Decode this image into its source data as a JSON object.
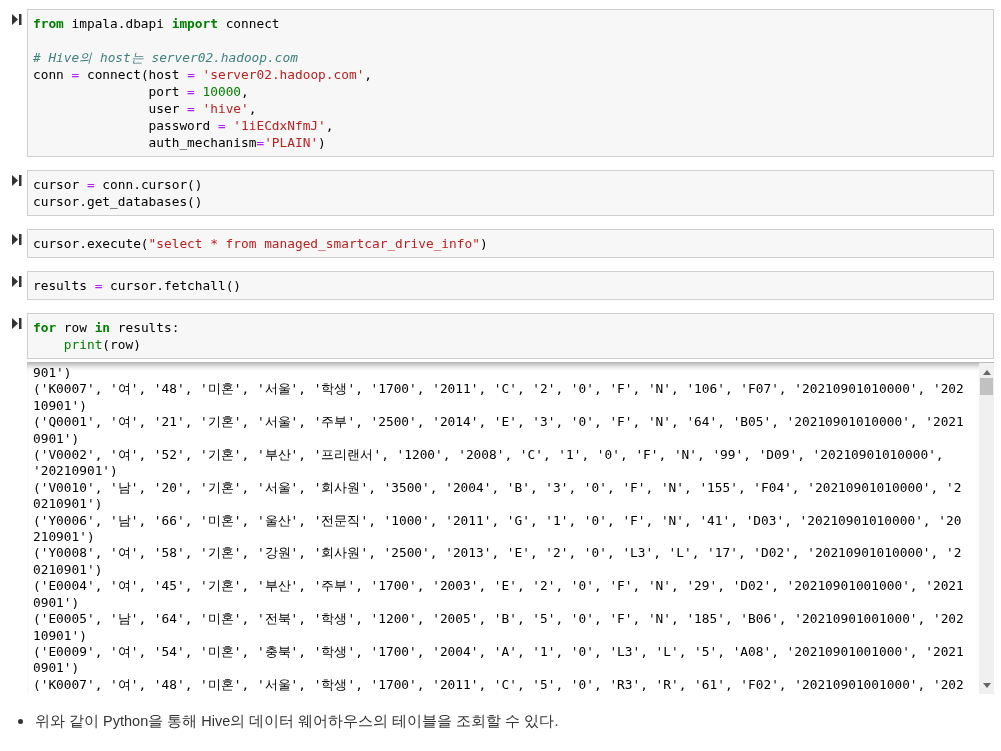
{
  "cells": [
    {
      "blocks": [
        [
          {
            "tokens": [
              {
                "kind": "kw",
                "text": "from"
              },
              {
                "kind": "plain",
                "text": " impala.dbapi "
              },
              {
                "kind": "kw",
                "text": "import"
              },
              {
                "kind": "plain",
                "text": " connect"
              }
            ]
          }
        ],
        [
          {
            "tokens": [
              {
                "kind": "comment",
                "text": "# Hive의 host는 server02.hadoop.com"
              }
            ]
          },
          {
            "tokens": [
              {
                "kind": "plain",
                "text": "conn "
              },
              {
                "kind": "op",
                "text": "="
              },
              {
                "kind": "plain",
                "text": " connect(host "
              },
              {
                "kind": "op",
                "text": "="
              },
              {
                "kind": "str",
                "text": " 'server02.hadoop.com'"
              },
              {
                "kind": "plain",
                "text": ","
              }
            ]
          },
          {
            "tokens": [
              {
                "kind": "plain",
                "text": "               port "
              },
              {
                "kind": "op",
                "text": "="
              },
              {
                "kind": "num",
                "text": " 10000"
              },
              {
                "kind": "plain",
                "text": ","
              }
            ]
          },
          {
            "tokens": [
              {
                "kind": "plain",
                "text": "               user "
              },
              {
                "kind": "op",
                "text": "="
              },
              {
                "kind": "str",
                "text": " 'hive'"
              },
              {
                "kind": "plain",
                "text": ","
              }
            ]
          },
          {
            "tokens": [
              {
                "kind": "plain",
                "text": "               password "
              },
              {
                "kind": "op",
                "text": "="
              },
              {
                "kind": "str",
                "text": " '1iECdxNfmJ'"
              },
              {
                "kind": "plain",
                "text": ","
              }
            ]
          },
          {
            "tokens": [
              {
                "kind": "plain",
                "text": "               auth_mechanism"
              },
              {
                "kind": "op",
                "text": "="
              },
              {
                "kind": "str",
                "text": "'PLAIN'"
              },
              {
                "kind": "plain",
                "text": ")"
              }
            ]
          }
        ]
      ]
    },
    {
      "blocks": [
        [
          {
            "tokens": [
              {
                "kind": "plain",
                "text": "cursor "
              },
              {
                "kind": "op",
                "text": "="
              },
              {
                "kind": "plain",
                "text": " conn.cursor()"
              }
            ]
          },
          {
            "tokens": [
              {
                "kind": "plain",
                "text": "cursor.get_databases()"
              }
            ]
          }
        ]
      ]
    },
    {
      "blocks": [
        [
          {
            "tokens": [
              {
                "kind": "plain",
                "text": "cursor.execute("
              },
              {
                "kind": "str",
                "text": "\"select * from managed_smartcar_drive_info\""
              },
              {
                "kind": "plain",
                "text": ")"
              }
            ]
          }
        ]
      ]
    },
    {
      "blocks": [
        [
          {
            "tokens": [
              {
                "kind": "plain",
                "text": "results "
              },
              {
                "kind": "op",
                "text": "="
              },
              {
                "kind": "plain",
                "text": " cursor.fetchall()"
              }
            ]
          }
        ]
      ]
    },
    {
      "blocks": [
        [
          {
            "tokens": [
              {
                "kind": "kw",
                "text": "for"
              },
              {
                "kind": "plain",
                "text": " row "
              },
              {
                "kind": "kw",
                "text": "in"
              },
              {
                "kind": "plain",
                "text": " results:"
              }
            ]
          },
          {
            "tokens": [
              {
                "kind": "builtin",
                "text": "    print"
              },
              {
                "kind": "plain",
                "text": "(row)"
              }
            ]
          }
        ]
      ],
      "output": [
        "901')",
        "('K0007', '여', '48', '미혼', '서울', '학생', '1700', '2011', 'C', '2', '0', 'F', 'N', '106', 'F07', '20210901010000', '202",
        "10901')",
        "('Q0001', '여', '21', '기혼', '서울', '주부', '2500', '2014', 'E', '3', '0', 'F', 'N', '64', 'B05', '20210901010000', '2021",
        "0901')",
        "('V0002', '여', '52', '기혼', '부산', '프리랜서', '1200', '2008', 'C', '1', '0', 'F', 'N', '99', 'D09', '20210901010000',",
        "'20210901')",
        "('V0010', '남', '20', '기혼', '서울', '회사원', '3500', '2004', 'B', '3', '0', 'F', 'N', '155', 'F04', '20210901010000', '2",
        "0210901')",
        "('Y0006', '남', '66', '미혼', '울산', '전문직', '1000', '2011', 'G', '1', '0', 'F', 'N', '41', 'D03', '20210901010000', '20",
        "210901')",
        "('Y0008', '여', '58', '기혼', '강원', '회사원', '2500', '2013', 'E', '2', '0', 'L3', 'L', '17', 'D02', '20210901010000', '2",
        "0210901')",
        "('E0004', '여', '45', '기혼', '부산', '주부', '1700', '2003', 'E', '2', '0', 'F', 'N', '29', 'D02', '20210901001000', '2021",
        "0901')",
        "('E0005', '남', '64', '미혼', '전북', '학생', '1200', '2005', 'B', '5', '0', 'F', 'N', '185', 'B06', '20210901001000', '202",
        "10901')",
        "('E0009', '여', '54', '미혼', '충북', '학생', '1700', '2004', 'A', '1', '0', 'L3', 'L', '5', 'A08', '20210901001000', '2021",
        "0901')",
        "('K0007', '여', '48', '미혼', '서울', '학생', '1700', '2011', 'C', '5', '0', 'R3', 'R', '61', 'F02', '20210901001000', '202"
      ]
    }
  ],
  "note": "위와 같이 Python을 통해 Hive의 데이터 웨어하우스의 테이블을 조회할 수 있다."
}
